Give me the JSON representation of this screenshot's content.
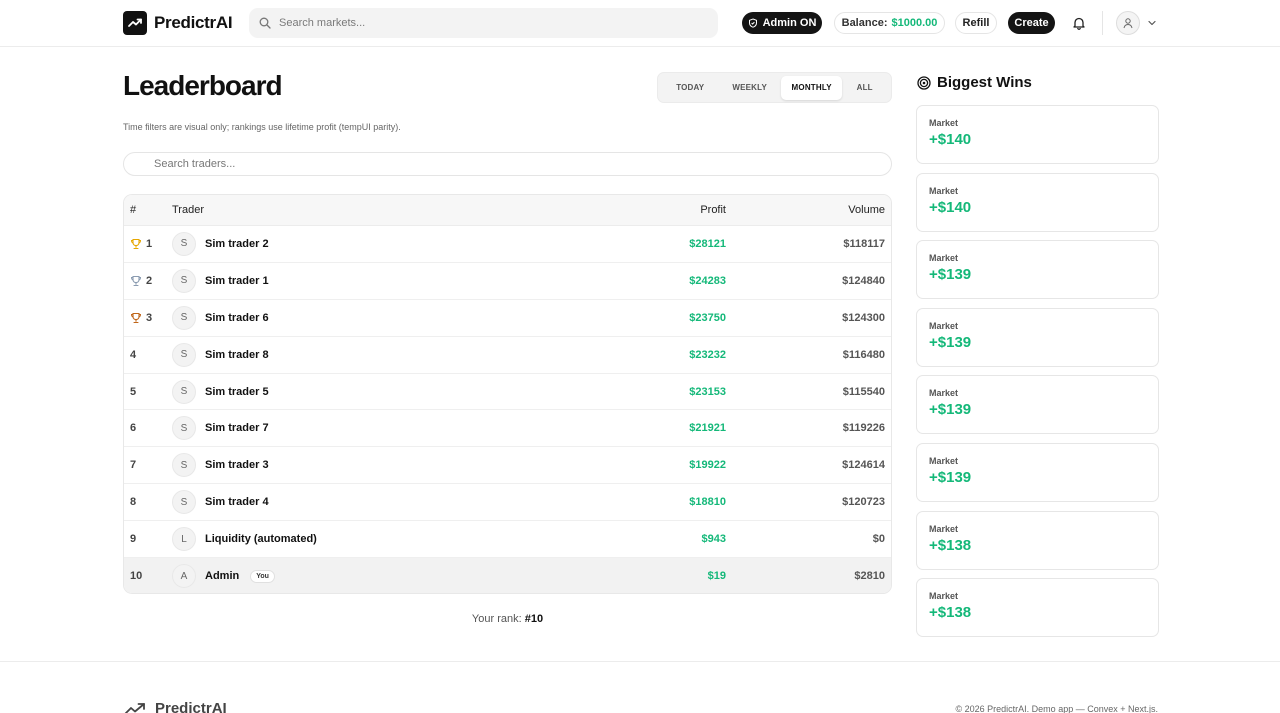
{
  "header": {
    "brand": "PredictrAI",
    "search_placeholder": "Search markets...",
    "admin_label": "Admin ON",
    "balance_label": "Balance:",
    "balance_value": "$1000.00",
    "refill_label": "Refill",
    "create_label": "Create"
  },
  "page": {
    "title": "Leaderboard",
    "note": "Time filters are visual only; rankings use lifetime profit (tempUI parity).",
    "trader_search_placeholder": "Search traders...",
    "time_filters": [
      "TODAY",
      "WEEKLY",
      "MONTHLY",
      "ALL"
    ],
    "active_filter": "MONTHLY"
  },
  "table": {
    "columns": {
      "rank": "#",
      "trader": "Trader",
      "profit": "Profit",
      "volume": "Volume"
    },
    "rows": [
      {
        "rank": "1",
        "initial": "S",
        "name": "Sim trader 2",
        "profit": "$28121",
        "volume": "$118117",
        "medal": "gold"
      },
      {
        "rank": "2",
        "initial": "S",
        "name": "Sim trader 1",
        "profit": "$24283",
        "volume": "$124840",
        "medal": "silver"
      },
      {
        "rank": "3",
        "initial": "S",
        "name": "Sim trader 6",
        "profit": "$23750",
        "volume": "$124300",
        "medal": "bronze"
      },
      {
        "rank": "4",
        "initial": "S",
        "name": "Sim trader 8",
        "profit": "$23232",
        "volume": "$116480"
      },
      {
        "rank": "5",
        "initial": "S",
        "name": "Sim trader 5",
        "profit": "$23153",
        "volume": "$115540"
      },
      {
        "rank": "6",
        "initial": "S",
        "name": "Sim trader 7",
        "profit": "$21921",
        "volume": "$119226"
      },
      {
        "rank": "7",
        "initial": "S",
        "name": "Sim trader 3",
        "profit": "$19922",
        "volume": "$124614"
      },
      {
        "rank": "8",
        "initial": "S",
        "name": "Sim trader 4",
        "profit": "$18810",
        "volume": "$120723"
      },
      {
        "rank": "9",
        "initial": "L",
        "name": "Liquidity (automated)",
        "profit": "$943",
        "volume": "$0"
      },
      {
        "rank": "10",
        "initial": "A",
        "name": "Admin",
        "profit": "$19",
        "volume": "$2810",
        "you": "You"
      }
    ]
  },
  "your_rank": {
    "label": "Your rank:",
    "value": "#10"
  },
  "sidebar": {
    "title": "Biggest Wins",
    "wins": [
      {
        "label": "Market",
        "amount": "+$140"
      },
      {
        "label": "Market",
        "amount": "+$140"
      },
      {
        "label": "Market",
        "amount": "+$139"
      },
      {
        "label": "Market",
        "amount": "+$139"
      },
      {
        "label": "Market",
        "amount": "+$139"
      },
      {
        "label": "Market",
        "amount": "+$139"
      },
      {
        "label": "Market",
        "amount": "+$138"
      },
      {
        "label": "Market",
        "amount": "+$138"
      }
    ]
  },
  "footer": {
    "brand": "PredictrAI",
    "copyright": "© 2026 PredictrAI. Demo app — Convex + Next.js."
  },
  "colors": {
    "accent_green": "#14b879",
    "dark": "#141414",
    "gold": "#e6a700",
    "silver": "#8a9bb0",
    "bronze": "#c0661a"
  }
}
